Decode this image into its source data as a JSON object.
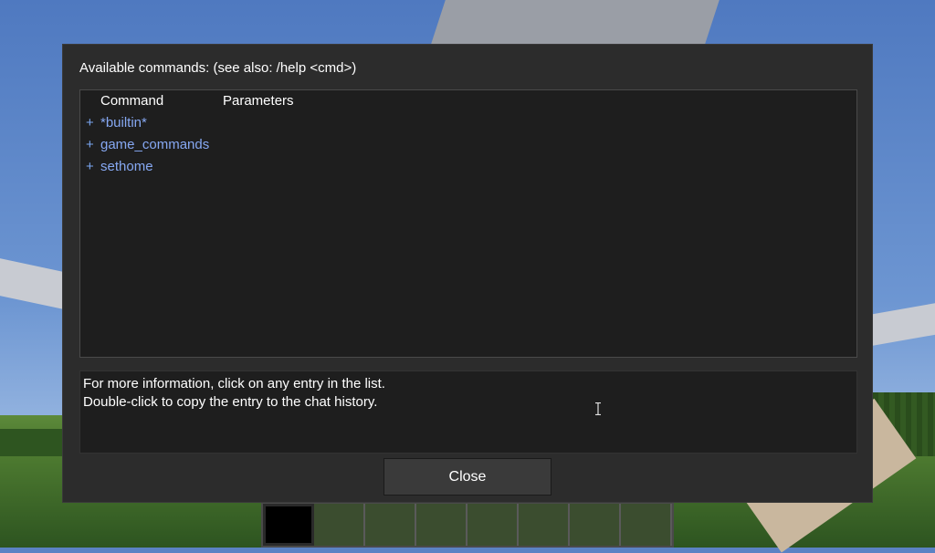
{
  "dialog": {
    "title": "Available commands: (see also: /help <cmd>)",
    "columns": {
      "command": "Command",
      "parameters": "Parameters"
    },
    "rows": [
      {
        "expander": "+",
        "name": "*builtin*"
      },
      {
        "expander": "+",
        "name": "game_commands"
      },
      {
        "expander": "+",
        "name": "sethome"
      }
    ],
    "info_lines": [
      "For more information, click on any entry in the list.",
      "Double-click to copy the entry to the chat history."
    ],
    "close_label": "Close"
  },
  "colors": {
    "dialog_bg": "#2c2c2c",
    "list_bg": "#1e1e1e",
    "link_blue": "#86a8f2"
  },
  "icons": {
    "cursor": "text-cursor-icon"
  }
}
